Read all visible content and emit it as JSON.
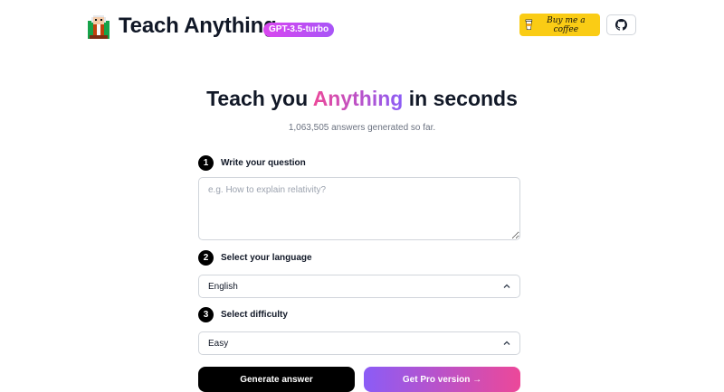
{
  "header": {
    "brand": "Teach Anything",
    "model_badge": "GPT-3.5-turbo",
    "coffee_label": "Buy me a coffee"
  },
  "hero": {
    "title_prefix": "Teach you ",
    "title_highlight": "Anything",
    "title_suffix": " in seconds",
    "subtitle": "1,063,505 answers generated so far."
  },
  "steps": [
    {
      "number": "1",
      "label": "Write your question"
    },
    {
      "number": "2",
      "label": "Select your language"
    },
    {
      "number": "3",
      "label": "Select difficulty"
    }
  ],
  "question": {
    "placeholder": "e.g. How to explain relativity?",
    "value": ""
  },
  "language": {
    "selected": "English"
  },
  "difficulty": {
    "selected": "Easy"
  },
  "actions": {
    "generate_label": "Generate answer",
    "pro_label": "Get Pro version →"
  },
  "colors": {
    "accent_yellow": "#facc15",
    "gradient_pink": "#ec4899",
    "gradient_purple": "#8b5cf6",
    "text_dark": "#111827"
  },
  "icons": {
    "logo": "teacher-pixel-icon",
    "coffee": "coffee-cup-icon",
    "github": "github-icon",
    "chevron": "chevron-up-icon"
  }
}
